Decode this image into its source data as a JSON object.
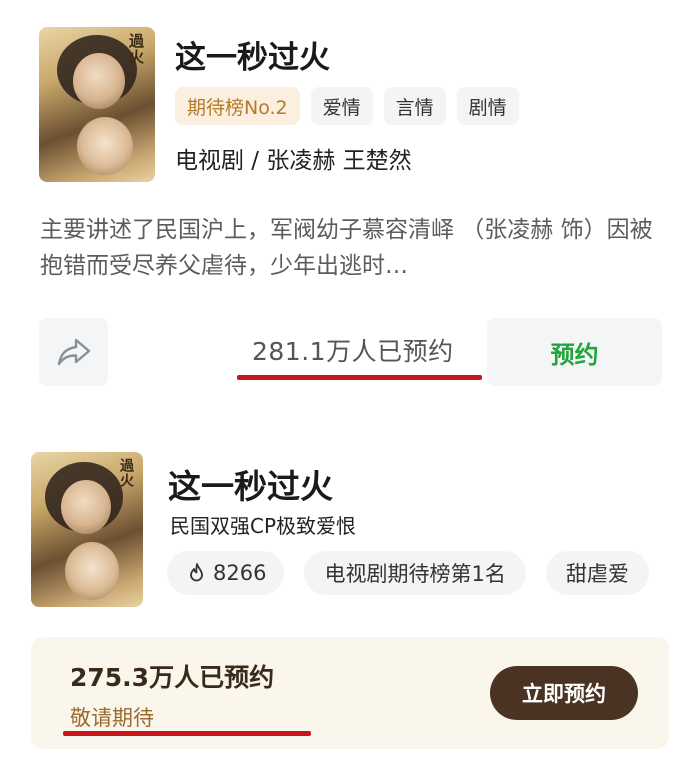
{
  "card1": {
    "poster_text": "過火",
    "title": "这一秒过火",
    "tags": [
      "期待榜No.2",
      "爱情",
      "言情",
      "剧情"
    ],
    "meta": "电视剧 / 张凌赫 王楚然",
    "description": "主要讲述了民国沪上，军阀幼子慕容清峄 （张凌赫 饰）因被抱错而受尽养父虐待，少年出逃时…",
    "share_icon": "share-arrow-icon",
    "reservation_count": "281.1万人已预约",
    "reserve_label": "预约",
    "accent_color": "#1fa53b"
  },
  "card2": {
    "poster_text": "過火",
    "title": "这一秒过火",
    "subtitle": "民国双强CP极致爱恨",
    "heat_icon": "flame-icon",
    "heat_value": "8266",
    "tags": [
      "电视剧期待榜第1名",
      "甜虐爱"
    ],
    "reservation_count": "275.3万人已预约",
    "hope_text": "敬请期待",
    "action_label": "立即预约",
    "button_color": "#4a3322"
  },
  "highlight_color": "#c8151b"
}
